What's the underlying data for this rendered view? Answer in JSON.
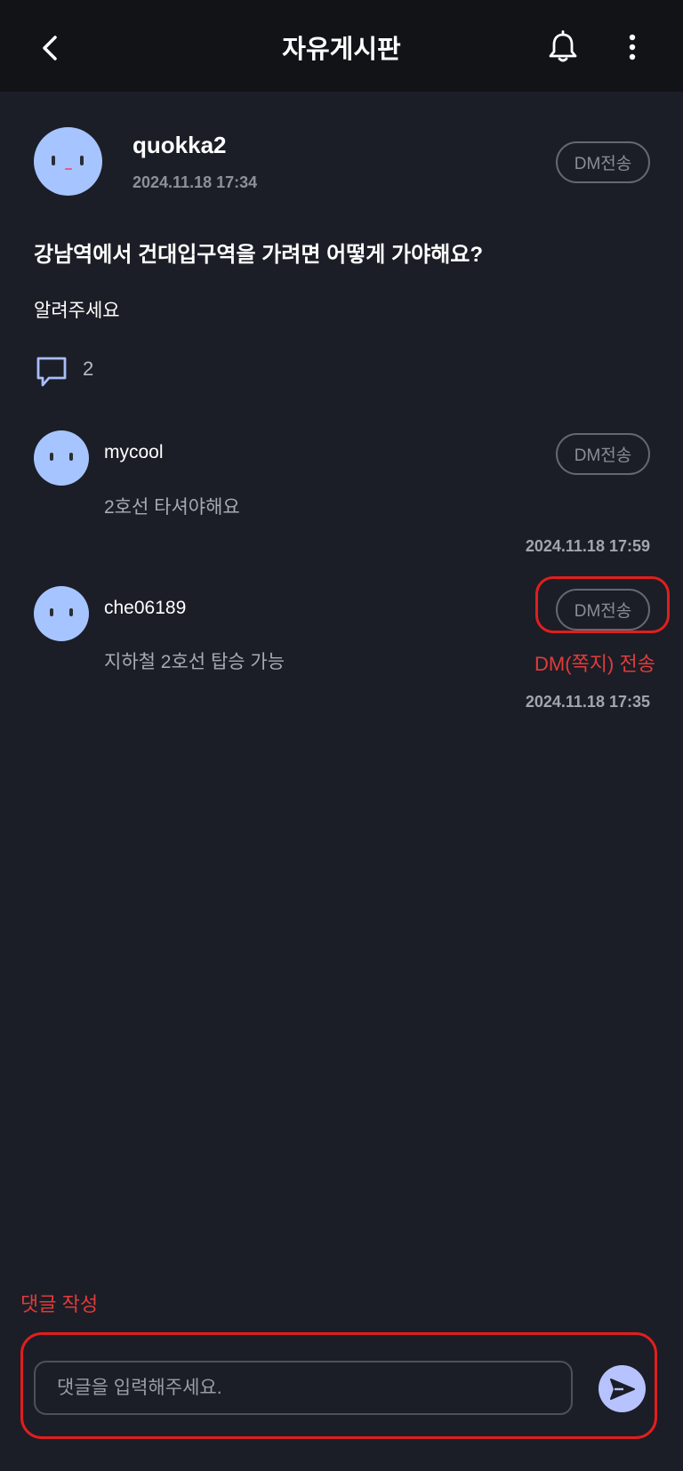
{
  "header": {
    "title": "자유게시판",
    "icons": {
      "back": "chevron-left-icon",
      "notification": "bell-icon",
      "more": "more-vertical-icon"
    }
  },
  "post": {
    "author": "quokka2",
    "date": "2024.11.18 17:34",
    "dm_label": "DM전송",
    "title": "강남역에서 건대입구역을 가려면 어떻게 가야해요?",
    "body": "알려주세요",
    "comment_count": "2"
  },
  "comments": [
    {
      "author": "mycool",
      "text": "2호선 타셔야해요",
      "date": "2024.11.18 17:59",
      "dm_label": "DM전송"
    },
    {
      "author": "che06189",
      "text": "지하철 2호선 탑승 가능",
      "date": "2024.11.18 17:35",
      "dm_label": "DM전송"
    }
  ],
  "annotations": {
    "dm_send": "DM(쪽지) 전송",
    "write_comment": "댓글 작성"
  },
  "comment_input": {
    "placeholder": "댓글을 입력해주세요.",
    "value": ""
  },
  "colors": {
    "background": "#1b1e26",
    "header": "#111317",
    "avatar": "#a6c4ff",
    "accent_send": "#b7c3ff",
    "annotation_red": "#e11e1e"
  }
}
